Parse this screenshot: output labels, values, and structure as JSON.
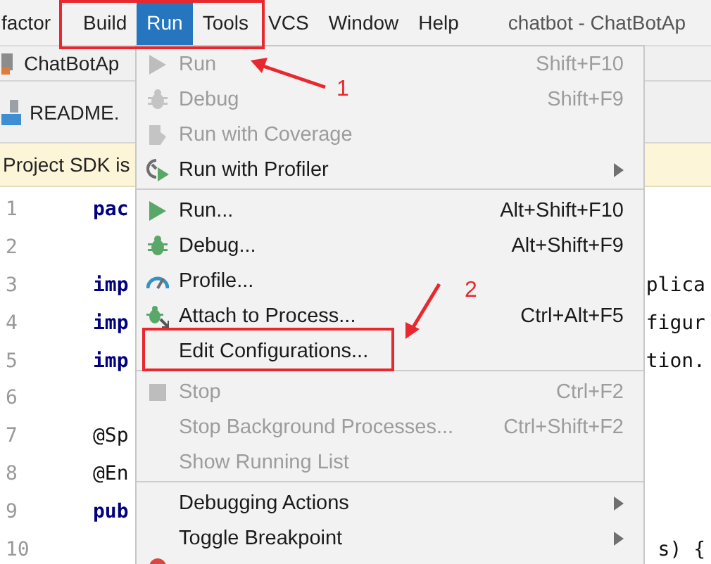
{
  "menubar": {
    "items": [
      {
        "label": "factor",
        "selected": false
      },
      {
        "label": "Build",
        "selected": false
      },
      {
        "label": "Run",
        "selected": true
      },
      {
        "label": "Tools",
        "selected": false
      },
      {
        "label": "VCS",
        "selected": false
      },
      {
        "label": "Window",
        "selected": false
      },
      {
        "label": "Help",
        "selected": false
      }
    ],
    "title": "chatbot - ChatBotAp"
  },
  "file_tabs": [
    {
      "label": "ChatBotAp"
    },
    {
      "label": "README."
    }
  ],
  "banner": "Project SDK is",
  "editor": {
    "lines": [
      {
        "number": "1",
        "left": "pac"
      },
      {
        "number": "2"
      },
      {
        "number": "3",
        "left": "imp",
        "right": "plica"
      },
      {
        "number": "4",
        "left": "imp",
        "right": "figur"
      },
      {
        "number": "5",
        "left": "imp",
        "right": "tion."
      },
      {
        "number": "6"
      },
      {
        "number": "7",
        "left": "@Sp"
      },
      {
        "number": "8",
        "left": "@En"
      },
      {
        "number": "9",
        "left": "pub"
      },
      {
        "number": "10",
        "right": "s) {"
      }
    ]
  },
  "run_menu": {
    "items": [
      {
        "kind": "run",
        "label": "Run",
        "shortcut": "Shift+F10",
        "disabled": true,
        "submenu": false
      },
      {
        "kind": "debug",
        "label": "Debug",
        "shortcut": "Shift+F9",
        "disabled": true,
        "submenu": false
      },
      {
        "kind": "coverage",
        "label": "Run with Coverage",
        "disabled": true,
        "submenu": false
      },
      {
        "kind": "profiler",
        "label": "Run with Profiler",
        "disabled": false,
        "submenu": true
      },
      {
        "kind": "separator"
      },
      {
        "kind": "run",
        "label": "Run...",
        "shortcut": "Alt+Shift+F10",
        "disabled": false,
        "submenu": false
      },
      {
        "kind": "debug",
        "label": "Debug...",
        "shortcut": "Alt+Shift+F9",
        "disabled": false,
        "submenu": false
      },
      {
        "kind": "profile",
        "label": "Profile...",
        "disabled": false,
        "submenu": false
      },
      {
        "kind": "attach",
        "label": "Attach to Process...",
        "shortcut": "Ctrl+Alt+F5",
        "disabled": false,
        "submenu": false
      },
      {
        "kind": "plain",
        "label": "Edit Configurations...",
        "disabled": false,
        "submenu": false
      },
      {
        "kind": "separator"
      },
      {
        "kind": "stop",
        "label": "Stop",
        "shortcut": "Ctrl+F2",
        "disabled": true,
        "submenu": false
      },
      {
        "kind": "plain",
        "label": "Stop Background Processes...",
        "shortcut": "Ctrl+Shift+F2",
        "disabled": true,
        "submenu": false
      },
      {
        "kind": "plain",
        "label": "Show Running List",
        "disabled": true,
        "submenu": false
      },
      {
        "kind": "separator"
      },
      {
        "kind": "plain",
        "label": "Debugging Actions",
        "disabled": false,
        "submenu": true
      },
      {
        "kind": "plain",
        "label": "Toggle Breakpoint",
        "disabled": false,
        "submenu": true
      }
    ]
  },
  "callouts": [
    {
      "label": "1"
    },
    {
      "label": "2"
    }
  ]
}
